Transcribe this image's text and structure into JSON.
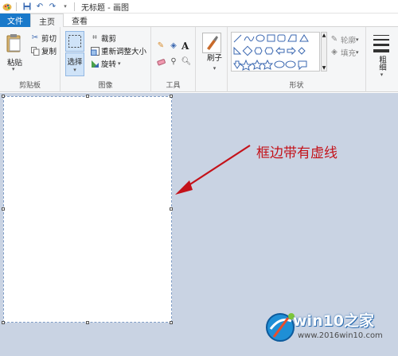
{
  "window": {
    "title": "无标题 - 画图"
  },
  "tabs": [
    "文件",
    "主页",
    "查看"
  ],
  "clipboard": {
    "paste": "粘贴",
    "cut": "剪切",
    "copy": "复制",
    "label": "剪贴板"
  },
  "image": {
    "select": "选择",
    "crop": "裁剪",
    "resize": "重新调整大小",
    "rotate": "旋转",
    "label": "图像"
  },
  "tools": {
    "label": "工具"
  },
  "brushes": {
    "label": "刷子"
  },
  "shapes": {
    "outline": "轮廓",
    "fill": "填充",
    "label": "形状"
  },
  "size": {
    "label": "粗细"
  },
  "annotation": "框边带有虚线",
  "watermark": {
    "title": "win10之家",
    "url": "www.2016win10.com"
  },
  "colors": {
    "accent": "#1979ca",
    "annotation": "#c4121a",
    "workspace": "#c9d3e3"
  }
}
